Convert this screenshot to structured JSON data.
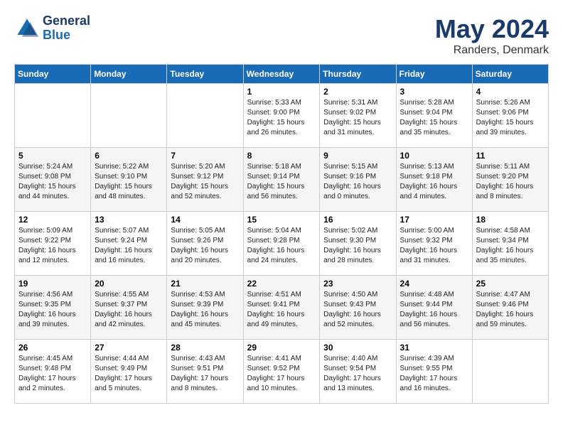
{
  "logo": {
    "line1": "General",
    "line2": "Blue"
  },
  "title": "May 2024",
  "subtitle": "Randers, Denmark",
  "weekdays": [
    "Sunday",
    "Monday",
    "Tuesday",
    "Wednesday",
    "Thursday",
    "Friday",
    "Saturday"
  ],
  "weeks": [
    [
      {
        "day": "",
        "sunrise": "",
        "sunset": "",
        "daylight": ""
      },
      {
        "day": "",
        "sunrise": "",
        "sunset": "",
        "daylight": ""
      },
      {
        "day": "",
        "sunrise": "",
        "sunset": "",
        "daylight": ""
      },
      {
        "day": "1",
        "sunrise": "Sunrise: 5:33 AM",
        "sunset": "Sunset: 9:00 PM",
        "daylight": "Daylight: 15 hours and 26 minutes."
      },
      {
        "day": "2",
        "sunrise": "Sunrise: 5:31 AM",
        "sunset": "Sunset: 9:02 PM",
        "daylight": "Daylight: 15 hours and 31 minutes."
      },
      {
        "day": "3",
        "sunrise": "Sunrise: 5:28 AM",
        "sunset": "Sunset: 9:04 PM",
        "daylight": "Daylight: 15 hours and 35 minutes."
      },
      {
        "day": "4",
        "sunrise": "Sunrise: 5:26 AM",
        "sunset": "Sunset: 9:06 PM",
        "daylight": "Daylight: 15 hours and 39 minutes."
      }
    ],
    [
      {
        "day": "5",
        "sunrise": "Sunrise: 5:24 AM",
        "sunset": "Sunset: 9:08 PM",
        "daylight": "Daylight: 15 hours and 44 minutes."
      },
      {
        "day": "6",
        "sunrise": "Sunrise: 5:22 AM",
        "sunset": "Sunset: 9:10 PM",
        "daylight": "Daylight: 15 hours and 48 minutes."
      },
      {
        "day": "7",
        "sunrise": "Sunrise: 5:20 AM",
        "sunset": "Sunset: 9:12 PM",
        "daylight": "Daylight: 15 hours and 52 minutes."
      },
      {
        "day": "8",
        "sunrise": "Sunrise: 5:18 AM",
        "sunset": "Sunset: 9:14 PM",
        "daylight": "Daylight: 15 hours and 56 minutes."
      },
      {
        "day": "9",
        "sunrise": "Sunrise: 5:15 AM",
        "sunset": "Sunset: 9:16 PM",
        "daylight": "Daylight: 16 hours and 0 minutes."
      },
      {
        "day": "10",
        "sunrise": "Sunrise: 5:13 AM",
        "sunset": "Sunset: 9:18 PM",
        "daylight": "Daylight: 16 hours and 4 minutes."
      },
      {
        "day": "11",
        "sunrise": "Sunrise: 5:11 AM",
        "sunset": "Sunset: 9:20 PM",
        "daylight": "Daylight: 16 hours and 8 minutes."
      }
    ],
    [
      {
        "day": "12",
        "sunrise": "Sunrise: 5:09 AM",
        "sunset": "Sunset: 9:22 PM",
        "daylight": "Daylight: 16 hours and 12 minutes."
      },
      {
        "day": "13",
        "sunrise": "Sunrise: 5:07 AM",
        "sunset": "Sunset: 9:24 PM",
        "daylight": "Daylight: 16 hours and 16 minutes."
      },
      {
        "day": "14",
        "sunrise": "Sunrise: 5:05 AM",
        "sunset": "Sunset: 9:26 PM",
        "daylight": "Daylight: 16 hours and 20 minutes."
      },
      {
        "day": "15",
        "sunrise": "Sunrise: 5:04 AM",
        "sunset": "Sunset: 9:28 PM",
        "daylight": "Daylight: 16 hours and 24 minutes."
      },
      {
        "day": "16",
        "sunrise": "Sunrise: 5:02 AM",
        "sunset": "Sunset: 9:30 PM",
        "daylight": "Daylight: 16 hours and 28 minutes."
      },
      {
        "day": "17",
        "sunrise": "Sunrise: 5:00 AM",
        "sunset": "Sunset: 9:32 PM",
        "daylight": "Daylight: 16 hours and 31 minutes."
      },
      {
        "day": "18",
        "sunrise": "Sunrise: 4:58 AM",
        "sunset": "Sunset: 9:34 PM",
        "daylight": "Daylight: 16 hours and 35 minutes."
      }
    ],
    [
      {
        "day": "19",
        "sunrise": "Sunrise: 4:56 AM",
        "sunset": "Sunset: 9:35 PM",
        "daylight": "Daylight: 16 hours and 39 minutes."
      },
      {
        "day": "20",
        "sunrise": "Sunrise: 4:55 AM",
        "sunset": "Sunset: 9:37 PM",
        "daylight": "Daylight: 16 hours and 42 minutes."
      },
      {
        "day": "21",
        "sunrise": "Sunrise: 4:53 AM",
        "sunset": "Sunset: 9:39 PM",
        "daylight": "Daylight: 16 hours and 45 minutes."
      },
      {
        "day": "22",
        "sunrise": "Sunrise: 4:51 AM",
        "sunset": "Sunset: 9:41 PM",
        "daylight": "Daylight: 16 hours and 49 minutes."
      },
      {
        "day": "23",
        "sunrise": "Sunrise: 4:50 AM",
        "sunset": "Sunset: 9:43 PM",
        "daylight": "Daylight: 16 hours and 52 minutes."
      },
      {
        "day": "24",
        "sunrise": "Sunrise: 4:48 AM",
        "sunset": "Sunset: 9:44 PM",
        "daylight": "Daylight: 16 hours and 56 minutes."
      },
      {
        "day": "25",
        "sunrise": "Sunrise: 4:47 AM",
        "sunset": "Sunset: 9:46 PM",
        "daylight": "Daylight: 16 hours and 59 minutes."
      }
    ],
    [
      {
        "day": "26",
        "sunrise": "Sunrise: 4:45 AM",
        "sunset": "Sunset: 9:48 PM",
        "daylight": "Daylight: 17 hours and 2 minutes."
      },
      {
        "day": "27",
        "sunrise": "Sunrise: 4:44 AM",
        "sunset": "Sunset: 9:49 PM",
        "daylight": "Daylight: 17 hours and 5 minutes."
      },
      {
        "day": "28",
        "sunrise": "Sunrise: 4:43 AM",
        "sunset": "Sunset: 9:51 PM",
        "daylight": "Daylight: 17 hours and 8 minutes."
      },
      {
        "day": "29",
        "sunrise": "Sunrise: 4:41 AM",
        "sunset": "Sunset: 9:52 PM",
        "daylight": "Daylight: 17 hours and 10 minutes."
      },
      {
        "day": "30",
        "sunrise": "Sunrise: 4:40 AM",
        "sunset": "Sunset: 9:54 PM",
        "daylight": "Daylight: 17 hours and 13 minutes."
      },
      {
        "day": "31",
        "sunrise": "Sunrise: 4:39 AM",
        "sunset": "Sunset: 9:55 PM",
        "daylight": "Daylight: 17 hours and 16 minutes."
      },
      {
        "day": "",
        "sunrise": "",
        "sunset": "",
        "daylight": ""
      }
    ]
  ]
}
